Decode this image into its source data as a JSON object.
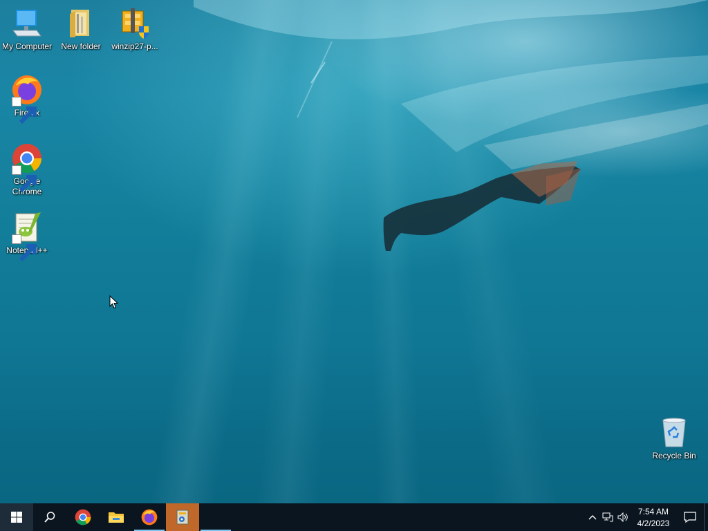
{
  "desktop": {
    "icons": [
      {
        "label": "My Computer",
        "icon": "computer-icon"
      },
      {
        "label": "New folder",
        "icon": "folder-icon"
      },
      {
        "label": "winzip27-p...",
        "icon": "winzip-installer-icon"
      },
      {
        "label": "Firefox",
        "icon": "firefox-icon"
      },
      {
        "label": "Google Chrome",
        "icon": "chrome-icon"
      },
      {
        "label": "Notepad++",
        "icon": "notepadpp-icon"
      },
      {
        "label": "Recycle Bin",
        "icon": "recycle-bin-icon"
      }
    ]
  },
  "taskbar": {
    "items": [
      {
        "name": "start",
        "icon": "windows-logo-icon"
      },
      {
        "name": "search",
        "icon": "search-icon"
      },
      {
        "name": "chrome",
        "icon": "chrome-icon"
      },
      {
        "name": "file-explorer",
        "icon": "folder-icon"
      },
      {
        "name": "firefox",
        "icon": "firefox-icon"
      },
      {
        "name": "winzip-setup",
        "icon": "installer-icon",
        "active": true
      }
    ],
    "tray": {
      "icons": [
        "chevron-up-icon",
        "network-icon",
        "volume-icon"
      ],
      "time": "7:54 AM",
      "date": "4/2/2023",
      "notification_icon": "notification-icon"
    }
  },
  "colors": {
    "taskbar_bg": "#0a1520",
    "active_task_bg": "#c0672a",
    "running_indicator": "#7fc6ee"
  }
}
